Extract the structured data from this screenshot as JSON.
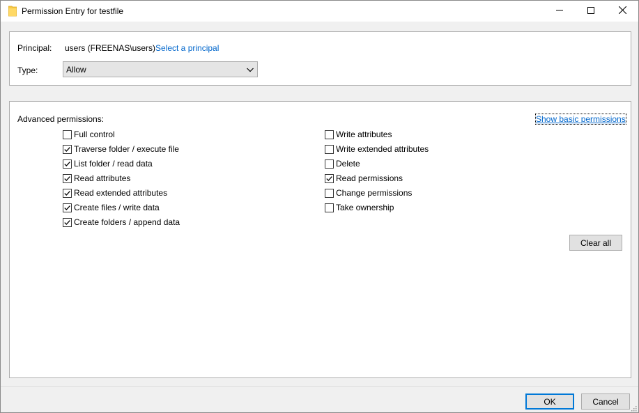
{
  "window": {
    "title": "Permission Entry for testfile",
    "icon": "folder-icon",
    "controls": [
      "minimize-icon",
      "maximize-icon",
      "close-icon"
    ]
  },
  "principal": {
    "label": "Principal:",
    "value": "users (FREENAS\\users)",
    "select_link": "Select a principal"
  },
  "type": {
    "label": "Type:",
    "selected": "Allow"
  },
  "advanced": {
    "label": "Advanced permissions:",
    "show_basic_link": "Show basic permissions",
    "left": [
      {
        "label": "Full control",
        "checked": false
      },
      {
        "label": "Traverse folder / execute file",
        "checked": true
      },
      {
        "label": "List folder / read data",
        "checked": true
      },
      {
        "label": "Read attributes",
        "checked": true
      },
      {
        "label": "Read extended attributes",
        "checked": true
      },
      {
        "label": "Create files / write data",
        "checked": true
      },
      {
        "label": "Create folders / append data",
        "checked": true
      }
    ],
    "right": [
      {
        "label": "Write attributes",
        "checked": false
      },
      {
        "label": "Write extended attributes",
        "checked": false
      },
      {
        "label": "Delete",
        "checked": false
      },
      {
        "label": "Read permissions",
        "checked": true
      },
      {
        "label": "Change permissions",
        "checked": false
      },
      {
        "label": "Take ownership",
        "checked": false
      }
    ],
    "clear_all": "Clear all"
  },
  "footer": {
    "ok": "OK",
    "cancel": "Cancel"
  },
  "colors": {
    "link": "#0066cc",
    "accent": "#0078d7",
    "panel_bg": "#ffffff",
    "window_bg": "#f0f0f0"
  }
}
